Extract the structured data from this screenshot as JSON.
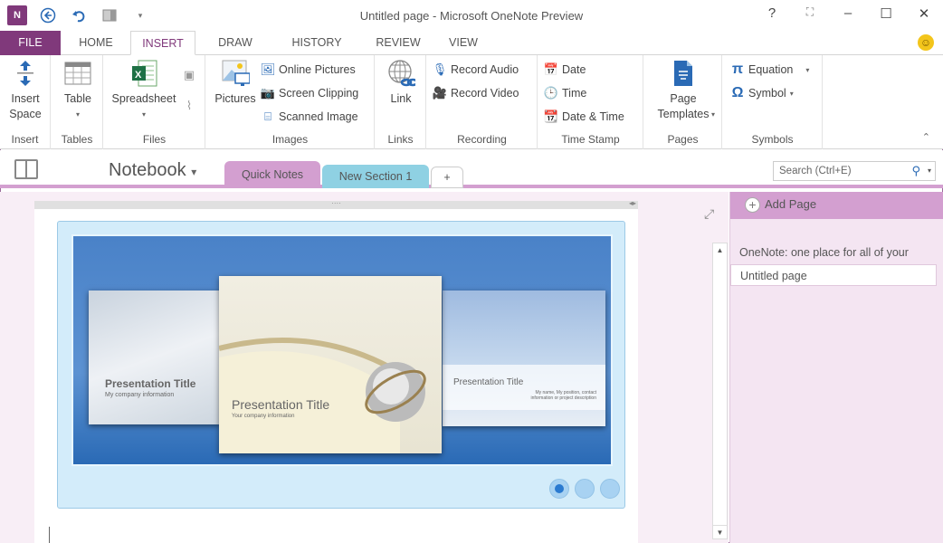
{
  "window": {
    "title": "Untitled page - Microsoft OneNote Preview",
    "app_icon": "N",
    "controls": [
      "?",
      "⛶",
      "–",
      "☐",
      "✕"
    ]
  },
  "qat": {
    "back": "back-icon",
    "undo": "undo-icon",
    "dock": "dock-icon",
    "customize": "▾"
  },
  "tabs": [
    "FILE",
    "HOME",
    "INSERT",
    "DRAW",
    "HISTORY",
    "REVIEW",
    "VIEW"
  ],
  "active_tab": "INSERT",
  "ribbon": {
    "groups": [
      {
        "label": "Insert",
        "buttons": [
          {
            "label": "Insert Space",
            "icon": "insert-space-icon"
          }
        ]
      },
      {
        "label": "Tables",
        "buttons": [
          {
            "label": "Table",
            "icon": "table-icon"
          }
        ]
      },
      {
        "label": "Files",
        "buttons": [
          {
            "label": "Spreadsheet",
            "icon": "excel-icon"
          },
          {
            "label": "",
            "icon": "file-printout-icon"
          },
          {
            "label": "",
            "icon": "attach-file-icon"
          }
        ]
      },
      {
        "label": "Images",
        "buttons": [
          {
            "label": "Pictures",
            "icon": "pictures-icon"
          },
          {
            "label": "Online Pictures",
            "icon": "online-pictures-icon"
          },
          {
            "label": "Screen Clipping",
            "icon": "screen-clipping-icon"
          },
          {
            "label": "Scanned Image",
            "icon": "scanner-icon"
          }
        ]
      },
      {
        "label": "Links",
        "buttons": [
          {
            "label": "Link",
            "icon": "link-icon"
          }
        ]
      },
      {
        "label": "Recording",
        "buttons": [
          {
            "label": "Record Audio",
            "icon": "mic-icon"
          },
          {
            "label": "Record Video",
            "icon": "video-icon"
          }
        ]
      },
      {
        "label": "Time Stamp",
        "buttons": [
          {
            "label": "Date",
            "icon": "calendar-icon"
          },
          {
            "label": "Time",
            "icon": "clock-icon"
          },
          {
            "label": "Date & Time",
            "icon": "date-time-icon"
          }
        ]
      },
      {
        "label": "Pages",
        "buttons": [
          {
            "label": "Page Templates",
            "icon": "page-template-icon"
          }
        ]
      },
      {
        "label": "Symbols",
        "buttons": [
          {
            "label": "Equation",
            "icon": "pi-icon"
          },
          {
            "label": "Symbol",
            "icon": "omega-icon"
          }
        ]
      }
    ]
  },
  "notebook": {
    "name": "Notebook",
    "sections": [
      {
        "label": "Quick Notes",
        "color": "#d39fd0"
      },
      {
        "label": "New Section 1",
        "color": "#8fd1e3"
      }
    ],
    "add_section": "+"
  },
  "search": {
    "placeholder": "Search (Ctrl+E)"
  },
  "gallery": {
    "slides": [
      {
        "title": "Presentation Title",
        "subtitle": "My company information"
      },
      {
        "title": "Presentation Title",
        "subtitle": "Your company information"
      },
      {
        "title": "Presentation Title",
        "subtitle": "My name, My position, contact information or project description"
      }
    ],
    "current_index": 1,
    "count": 3
  },
  "pages_pane": {
    "add_page": "Add Page",
    "pages": [
      "OneNote: one place for all of your",
      "Untitled page"
    ],
    "selected": "Untitled page"
  }
}
